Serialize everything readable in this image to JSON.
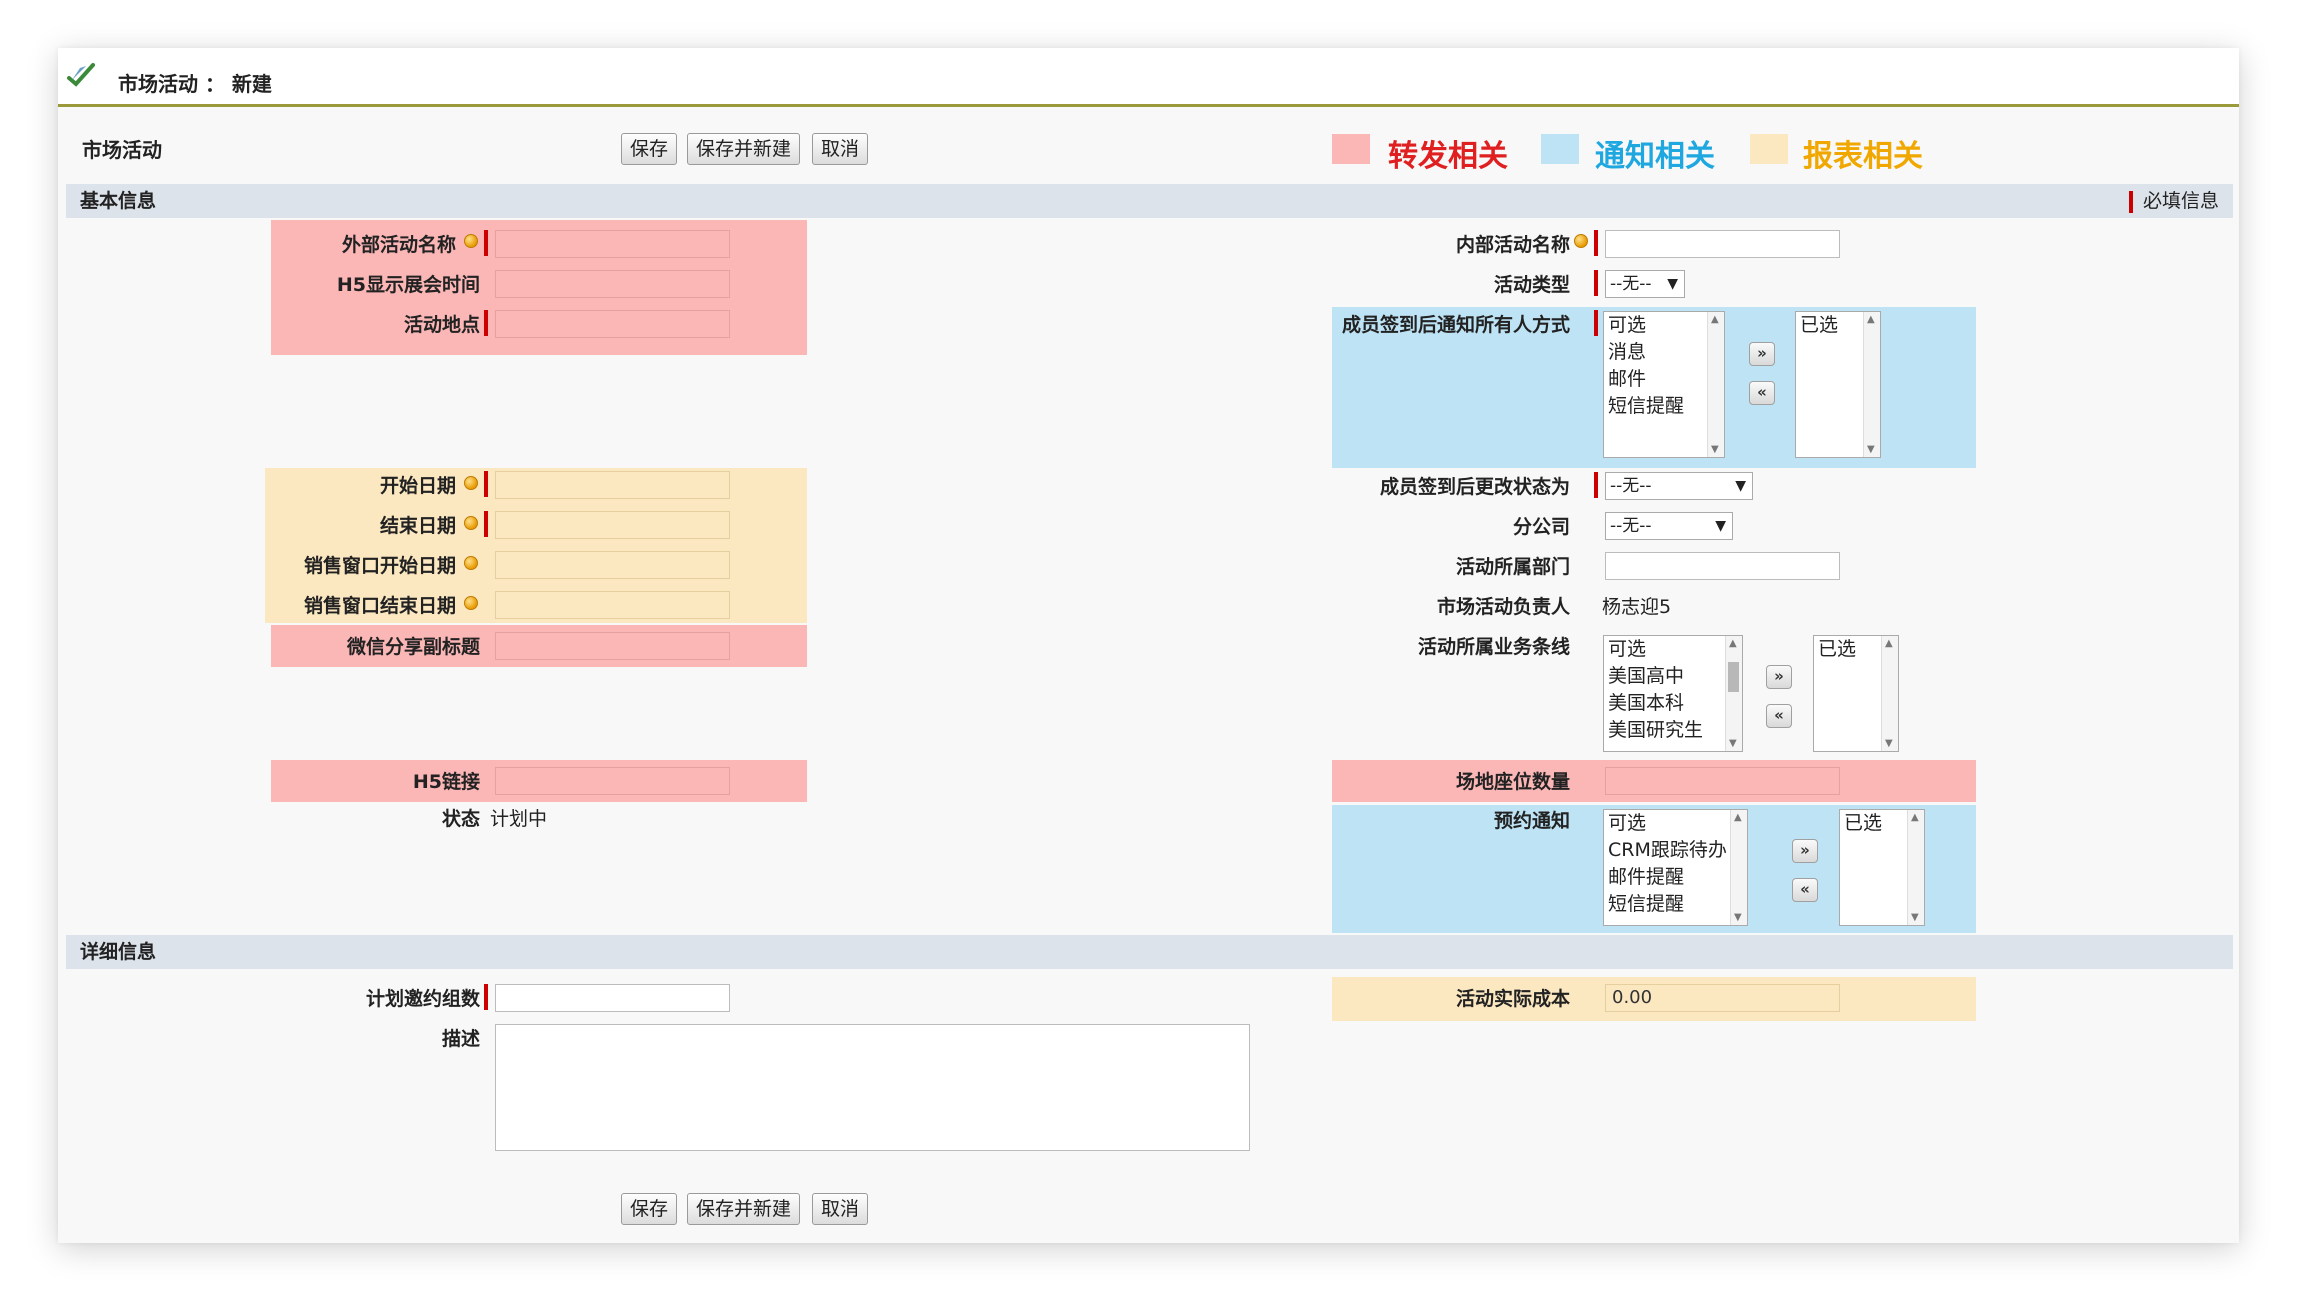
{
  "page": {
    "title": "市场活动 ： 新建",
    "form_name": "市场活动"
  },
  "toolbar": {
    "save": "保存",
    "save_new": "保存并新建",
    "cancel": "取消"
  },
  "legend": {
    "forward": {
      "label": "转发相关",
      "color": "#fbb6b6",
      "text_color": "#e02020"
    },
    "notify": {
      "label": "通知相关",
      "color": "#bee3f5",
      "text_color": "#1fa7e0"
    },
    "report": {
      "label": "报表相关",
      "color": "#fbe7c0",
      "text_color": "#f0a800"
    }
  },
  "sections": {
    "basic": "基本信息",
    "required_legend": "必填信息",
    "detail": "详细信息"
  },
  "fields": {
    "external_name": {
      "label": "外部活动名称",
      "value": ""
    },
    "h5_show_time": {
      "label": "H5显示展会时间",
      "value": ""
    },
    "location": {
      "label": "活动地点",
      "value": ""
    },
    "start_date": {
      "label": "开始日期",
      "value": ""
    },
    "end_date": {
      "label": "结束日期",
      "value": ""
    },
    "sales_start": {
      "label": "销售窗口开始日期",
      "value": ""
    },
    "sales_end": {
      "label": "销售窗口结束日期",
      "value": ""
    },
    "wechat_subtitle": {
      "label": "微信分享副标题",
      "value": ""
    },
    "h5_link": {
      "label": "H5链接",
      "value": ""
    },
    "status": {
      "label": "状态",
      "value": "计划中"
    },
    "internal_name": {
      "label": "内部活动名称",
      "value": ""
    },
    "activity_type": {
      "label": "活动类型",
      "value": "--无--"
    },
    "checkin_notify": {
      "label": "成员签到后通知所有人方式",
      "available_header": "可选",
      "available": [
        "消息",
        "邮件",
        "短信提醒"
      ],
      "selected_header": "已选"
    },
    "checkin_status": {
      "label": "成员签到后更改状态为",
      "value": "--无--"
    },
    "branch": {
      "label": "分公司",
      "value": "--无--"
    },
    "department": {
      "label": "活动所属部门",
      "value": ""
    },
    "owner": {
      "label": "市场活动负责人",
      "value": "杨志迎5"
    },
    "business_line": {
      "label": "活动所属业务条线",
      "available_header": "可选",
      "available": [
        "美国高中",
        "美国本科",
        "美国研究生"
      ],
      "selected_header": "已选"
    },
    "seat_count": {
      "label": "场地座位数量",
      "value": ""
    },
    "booking_notify": {
      "label": "预约通知",
      "available_header": "可选",
      "available": [
        "CRM跟踪待办",
        "邮件提醒",
        "短信提醒"
      ],
      "selected_header": "已选"
    },
    "invite_groups": {
      "label": "计划邀约组数",
      "value": ""
    },
    "actual_cost": {
      "label": "活动实际成本",
      "value": "0.00"
    },
    "description": {
      "label": "描述",
      "value": ""
    }
  },
  "icons": {
    "logo": "check-feather-icon",
    "required": "required-dot-icon",
    "move_right": "»",
    "move_left": "«"
  }
}
